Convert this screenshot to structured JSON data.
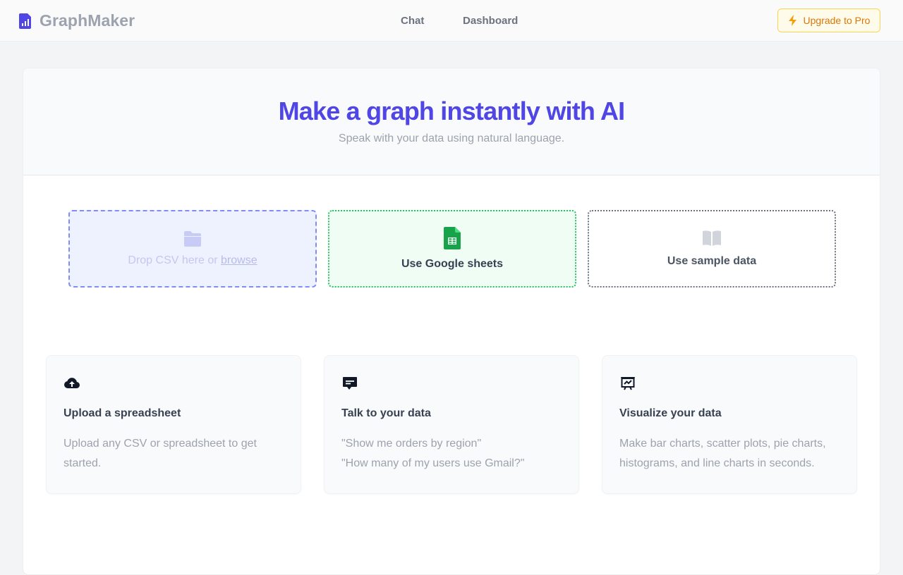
{
  "brand": {
    "name": "GraphMaker",
    "icon": "chart-file-icon"
  },
  "nav": {
    "items": [
      {
        "label": "Chat"
      },
      {
        "label": "Dashboard"
      }
    ]
  },
  "upgrade": {
    "label": "Upgrade to Pro",
    "icon": "lightning-icon"
  },
  "hero": {
    "title": "Make a graph instantly with AI",
    "subtitle": "Speak with your data using natural language."
  },
  "sources": {
    "csv": {
      "label_prefix": "Drop CSV here or",
      "link": "browse",
      "icon": "folder-icon"
    },
    "google": {
      "label": "Use Google sheets",
      "icon": "google-sheets-icon"
    },
    "sample": {
      "label": "Use sample data",
      "icon": "book-icon"
    }
  },
  "features": [
    {
      "icon": "cloud-upload-icon",
      "title": "Upload a spreadsheet",
      "lines": [
        "Upload any CSV or spreadsheet to get started."
      ]
    },
    {
      "icon": "chat-bubble-icon",
      "title": "Talk to your data",
      "lines": [
        "\"Show me orders by region\"",
        "\"How many of my users use Gmail?\""
      ]
    },
    {
      "icon": "presentation-chart-icon",
      "title": "Visualize your data",
      "lines": [
        "Make bar charts, scatter plots, pie charts, histograms, and line charts in seconds."
      ]
    }
  ],
  "colors": {
    "accent": "#4f46e5",
    "upgrade": "#d97706",
    "google_green": "#16a34a"
  }
}
